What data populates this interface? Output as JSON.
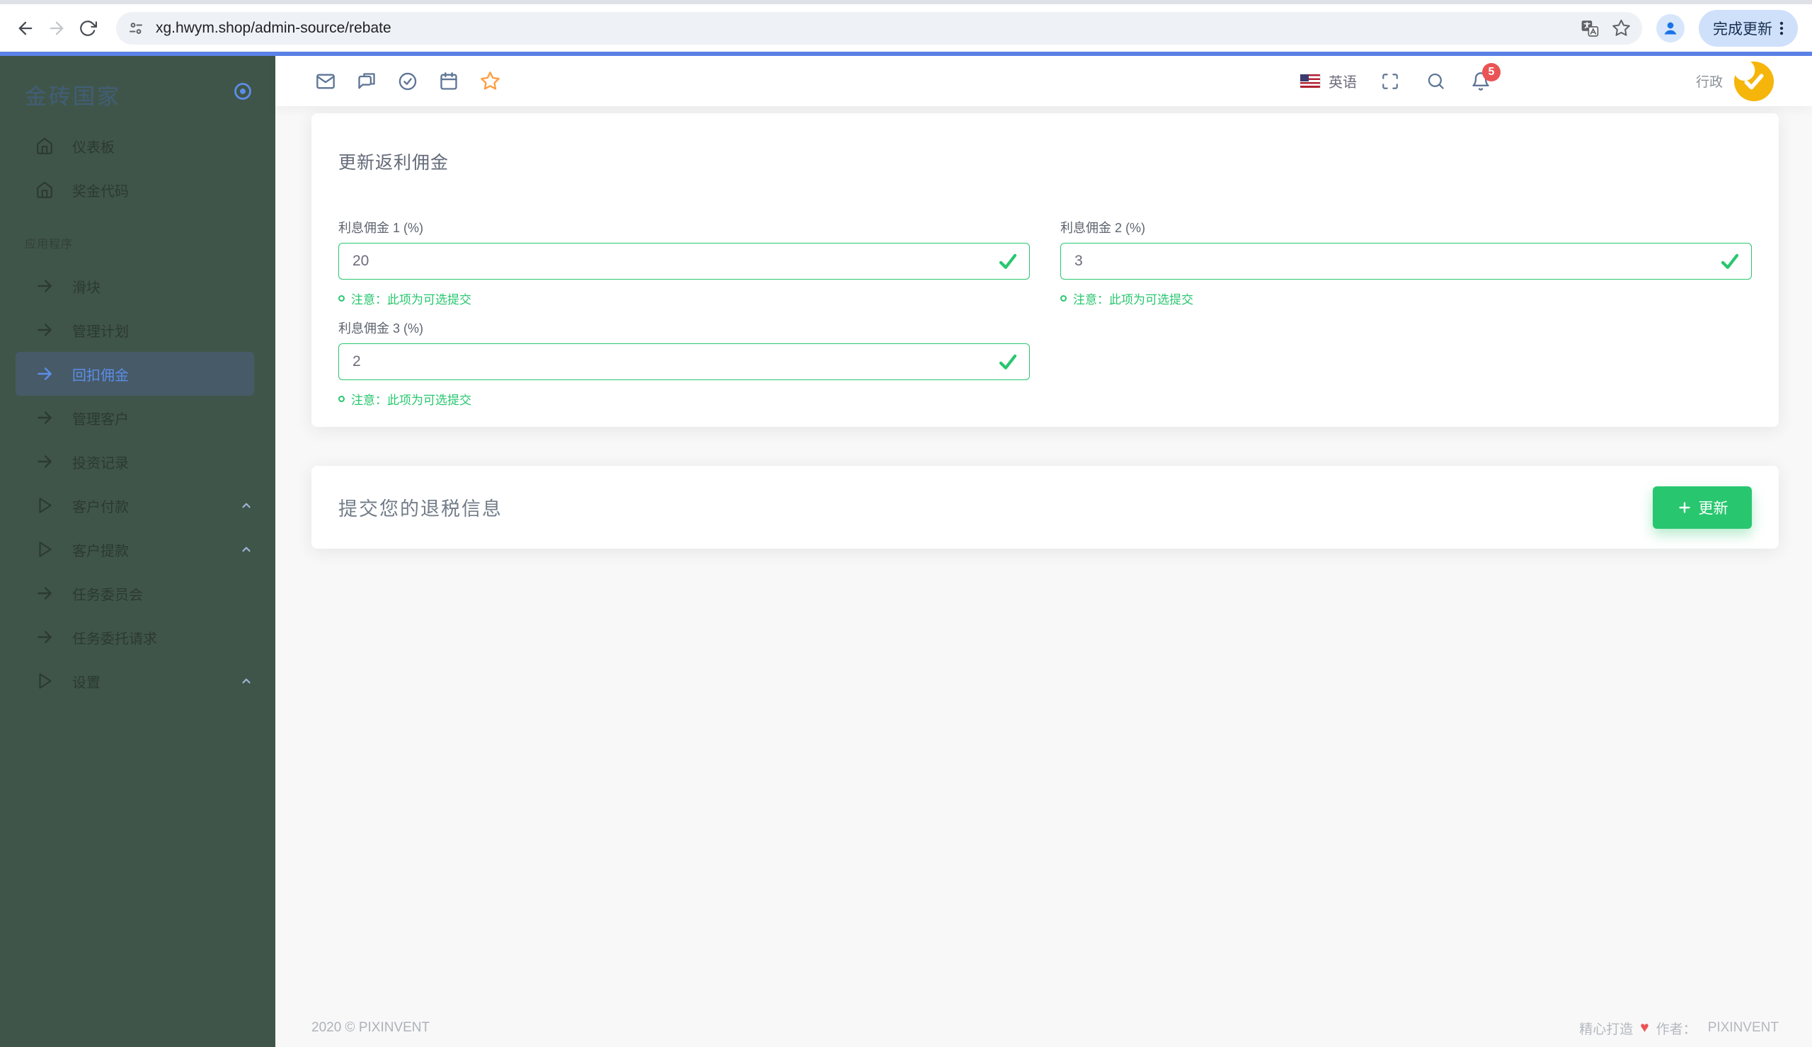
{
  "browser": {
    "url": "xg.hwym.shop/admin-source/rebate",
    "update_button": "完成更新"
  },
  "sidebar": {
    "brand": "金砖国家",
    "section_label": "应用程序",
    "items": [
      {
        "label": "仪表板"
      },
      {
        "label": "奖金代码"
      },
      {
        "label": "滑块"
      },
      {
        "label": "管理计划"
      },
      {
        "label": "回扣佣金"
      },
      {
        "label": "管理客户"
      },
      {
        "label": "投资记录"
      },
      {
        "label": "客户付款"
      },
      {
        "label": "客户提款"
      },
      {
        "label": "任务委员会"
      },
      {
        "label": "任务委托请求"
      },
      {
        "label": "设置"
      }
    ]
  },
  "navbar": {
    "language": "英语",
    "notification_count": "5",
    "user_role": "行政"
  },
  "rebate_card": {
    "title": "更新返利佣金",
    "fields": [
      {
        "label": "利息佣金 1 (%)",
        "value": "20",
        "hint": "注意：此项为可选提交"
      },
      {
        "label": "利息佣金 2 (%)",
        "value": "3",
        "hint": "注意：此项为可选提交"
      },
      {
        "label": "利息佣金 3 (%)",
        "value": "2",
        "hint": "注意：此项为可选提交"
      }
    ]
  },
  "tax_card": {
    "title": "提交您的退税信息",
    "button_label": "更新"
  },
  "footer": {
    "copyright": "2020 © PIXINVENT",
    "made_with": "精心打造",
    "heart": "♥",
    "author_label": "作者：",
    "author": "PIXINVENT"
  },
  "colors": {
    "accent_green": "#28c76f",
    "active_blue": "#5b8ee8",
    "star_orange": "#ff9f43",
    "badge_red": "#ea5455",
    "sidebar_bg": "#405549",
    "topline_blue": "#5b82e8",
    "avatar_yellow": "#f5b50a"
  }
}
